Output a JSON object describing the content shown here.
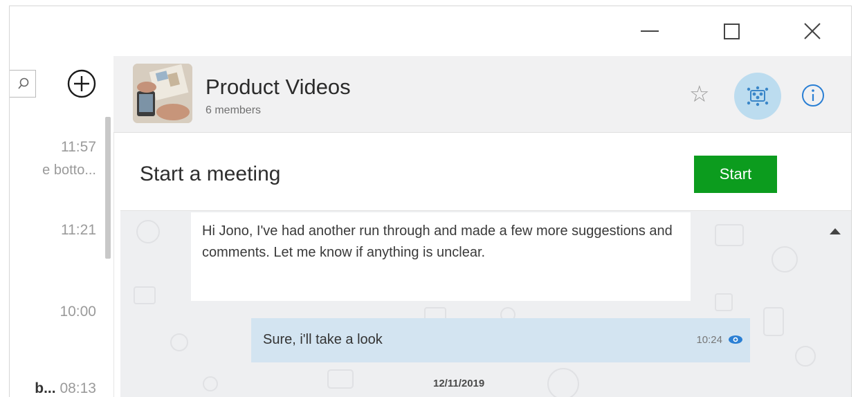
{
  "window_controls": {
    "minimize_icon": "minimize-icon",
    "maximize_icon": "maximize-icon",
    "close_icon": "close-icon"
  },
  "left_panel": {
    "search_icon": "search-icon",
    "add_icon": "plus-circle-icon",
    "chats": [
      {
        "time": "11:57",
        "snippet": "e botto..."
      },
      {
        "time": "11:21",
        "snippet": ""
      },
      {
        "time": "10:00",
        "snippet": ""
      },
      {
        "name": "b...",
        "time": "08:13"
      }
    ]
  },
  "header": {
    "title": "Product Videos",
    "subtitle": "6 members",
    "favorite_icon": "star-icon",
    "meeting_icon": "meeting-icon",
    "info_icon": "info-icon"
  },
  "meeting_banner": {
    "label": "Start a meeting",
    "button": "Start",
    "button_color": "#0c9c1e"
  },
  "conversation": {
    "incoming_message": "Hi Jono, I've had another run through and made a few more suggestions and comments. Let me know if anything is unclear.",
    "outgoing_message": "Sure, i'll take a look",
    "outgoing_time": "10:24",
    "seen_icon": "eye-icon",
    "date_separator": "12/11/2019",
    "scroll_icon": "chevron-up-icon"
  }
}
